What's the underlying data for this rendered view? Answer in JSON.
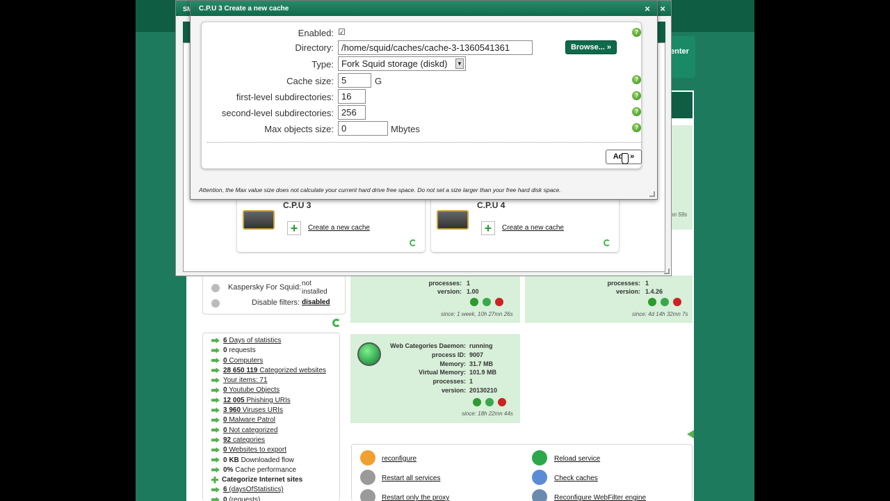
{
  "outer_dialog": {
    "title": "SM"
  },
  "background_page": {
    "teal_buttons": {
      "right_fragment": "enter"
    },
    "status_rows": [
      {
        "label": "Kaspersky For Squid:",
        "value": "not installed"
      },
      {
        "label": "Disable filters:",
        "value": "disabled"
      }
    ],
    "service_left": {
      "processes_label": "processes:",
      "processes": "1",
      "version_label": "version:",
      "version": "1.00",
      "since": "since: 1 week, 10h 27mn 26s"
    },
    "service_right": {
      "processes_label": "processes:",
      "processes": "1",
      "version_label": "version:",
      "version": "1.4.26",
      "since": "since: 4d 14h 32mn 7s",
      "fragment": "mn 59s"
    },
    "web_categories": {
      "rows": [
        {
          "label": "Web Categories Daemon:",
          "value": "running"
        },
        {
          "label": "process ID:",
          "value": "9007"
        },
        {
          "label": "Memory:",
          "value": "31.7 MB"
        },
        {
          "label": "Virtual Memory:",
          "value": "101.9 MB"
        },
        {
          "label": "processes:",
          "value": "1"
        },
        {
          "label": "version:",
          "value": "20130210"
        }
      ],
      "since": "since: 18h 22mn 44s"
    },
    "stats": [
      {
        "bold": "6",
        "text": " Days of statistics",
        "link": true
      },
      {
        "bold": "0",
        "text": " requests",
        "link": false
      },
      {
        "bold": "0",
        "text": " Computers",
        "link": true
      },
      {
        "bold": "28 650 119",
        "text": " Categorized websites",
        "link": true
      },
      {
        "bold": "",
        "text": "Your items: 71",
        "link": true
      },
      {
        "bold": "0",
        "text": " Youtube Objects",
        "link": true
      },
      {
        "bold": "12 005",
        "text": " Phishing URIs",
        "link": true
      },
      {
        "bold": "3 960",
        "text": " Viruses URIs",
        "link": true
      },
      {
        "bold": "0",
        "text": " Malware Patrol",
        "link": true
      },
      {
        "bold": "0",
        "text": " Not categorized",
        "link": true
      },
      {
        "bold": "92",
        "text": " categories",
        "link": true
      },
      {
        "bold": "0",
        "text": " Websites to export",
        "link": true
      },
      {
        "bold": "0 KB",
        "text": " Downloaded flow",
        "link": false
      },
      {
        "bold": "0%",
        "text": " Cache performance",
        "link": false
      },
      {
        "bold": "",
        "text": "Categorize Internet sites",
        "link": false
      },
      {
        "bold": "6",
        "text": " (daysOfStatistics)",
        "link": true
      },
      {
        "bold": "0",
        "text": " (requests)",
        "link": true
      }
    ],
    "actions": {
      "left": [
        "reconfigure",
        "Restart all services",
        "Restart only the proxy"
      ],
      "right": [
        "Reload service",
        "Check caches",
        "Reconfigure WebFilter engine"
      ]
    },
    "cpu_cards": [
      {
        "title": "C.P.U 3",
        "link": "Create a new cache"
      },
      {
        "title": "C.P.U 4",
        "link": "Create a new cache"
      }
    ]
  },
  "dialog": {
    "title": "C.P.U 3 Create a new cache",
    "close_glyph": "×",
    "enabled_label": "Enabled:",
    "enabled_check": "☑",
    "directory_label": "Directory:",
    "directory_value": "/home/squid/caches/cache-3-1360541361",
    "browse_label": "Browse... »",
    "type_label": "Type:",
    "type_value": "Fork Squid storage (diskd)",
    "cache_size_label": "Cache size:",
    "cache_size_value": "5",
    "cache_size_unit": "G",
    "first_label": "first-level subdirectories:",
    "first_value": "16",
    "second_label": "second-level subdirectories:",
    "second_value": "256",
    "maxobj_label": "Max objects size:",
    "maxobj_value": "0",
    "maxobj_unit": "Mbytes",
    "add_label": "Add »",
    "help_glyph": "?",
    "attention": "Attention, the Max value size does not calculate your current hard drive free space. Do not set a size larger than your free hard disk space."
  }
}
